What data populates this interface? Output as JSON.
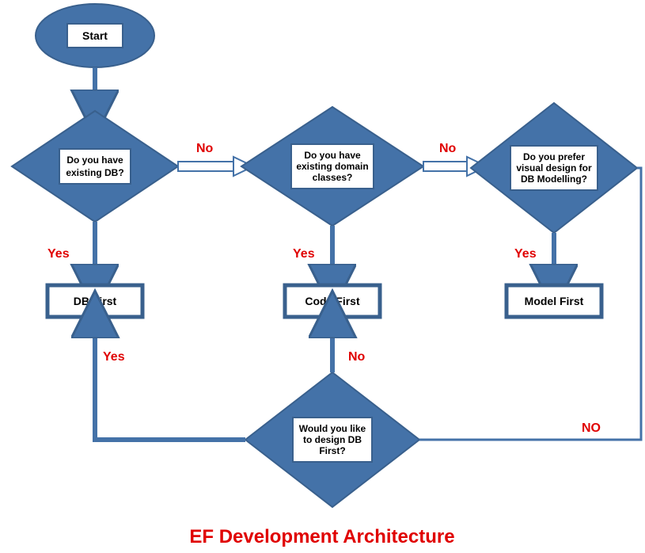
{
  "title": "EF Development Architecture",
  "nodes": {
    "start": "Start",
    "decision1_l1": "Do you have",
    "decision1_l2": "existing DB?",
    "decision2_l1": "Do you have",
    "decision2_l2": "existing domain",
    "decision2_l3": "classes?",
    "decision3_l1": "Do you prefer",
    "decision3_l2": "visual design for",
    "decision3_l3": "DB Modelling?",
    "decision4_l1": "Would you like",
    "decision4_l2": "to design DB",
    "decision4_l3": "First?",
    "result1": "DB First",
    "result2": "Code First",
    "result3": "Model First"
  },
  "labels": {
    "yes": "Yes",
    "no": "No",
    "no_caps": "NO"
  }
}
